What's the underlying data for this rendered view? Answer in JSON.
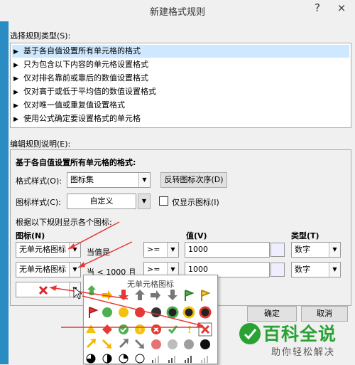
{
  "window": {
    "title": "新建格式规则",
    "help": "?",
    "close": "×"
  },
  "rule_types": {
    "label": "选择规则类型(S):",
    "items": [
      "基于各自值设置所有单元格的格式",
      "只为包含以下内容的单元格设置格式",
      "仅对排名靠前或靠后的数值设置格式",
      "仅对高于或低于平均值的数值设置格式",
      "仅对唯一值或重复值设置格式",
      "使用公式确定要设置格式的单元格"
    ],
    "selected_index": 0
  },
  "edit": {
    "label": "编辑规则说明(E):",
    "heading": "基于各自值设置所有单元格的格式:",
    "format_style_label": "格式样式(O):",
    "format_style_value": "图标集",
    "reverse_button": "反转图标次序(D)",
    "icon_style_label": "图标样式(C):",
    "icon_style_value": "自定义",
    "show_icon_only": "仅显示图标(I)",
    "rules_caption": "根据以下规则显示各个图标:",
    "col_icon": "图标(N)",
    "col_value": "值(V)",
    "col_type": "类型(T)",
    "rows": [
      {
        "icon": "无单元格图标",
        "cond": "当值是",
        "op": ">=",
        "value": "1000",
        "type": "数字"
      },
      {
        "icon": "无单元格图标",
        "cond": "当 < 1000 且",
        "op": ">=",
        "value": "1000",
        "type": "数字"
      }
    ]
  },
  "popup": {
    "title": "无单元格图标"
  },
  "buttons": {
    "ok": "确定",
    "cancel": "取消"
  },
  "watermark": {
    "main": "百科全说",
    "sub": "助你轻松解决"
  }
}
